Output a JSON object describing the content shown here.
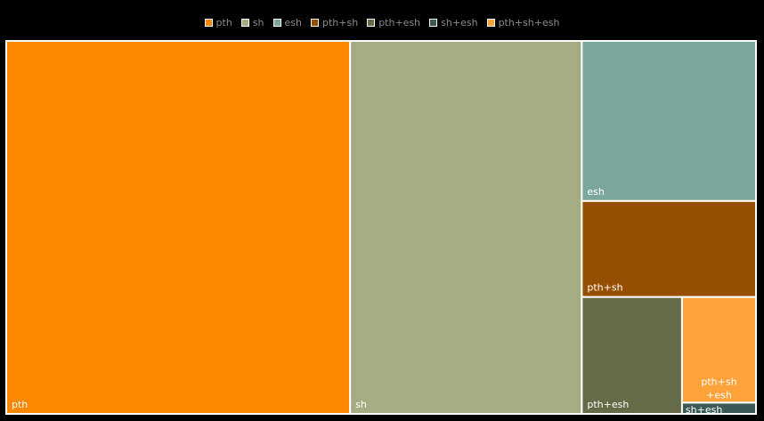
{
  "chart_data": {
    "type": "treemap",
    "legend_position": "top",
    "items": [
      {
        "name": "pth",
        "value": 46,
        "color": "#ff8800"
      },
      {
        "name": "sh",
        "value": 31,
        "color": "#a5ac82"
      },
      {
        "name": "esh",
        "value": 10,
        "color": "#7ba69b"
      },
      {
        "name": "pth+sh",
        "value": 6,
        "color": "#964f00"
      },
      {
        "name": "pth+esh",
        "value": 4.2,
        "color": "#656b46"
      },
      {
        "name": "sh+esh",
        "value": 0.3,
        "color": "#3a5955"
      },
      {
        "name": "pth+sh+esh",
        "value": 2.8,
        "color": "#ffa23a"
      }
    ]
  }
}
